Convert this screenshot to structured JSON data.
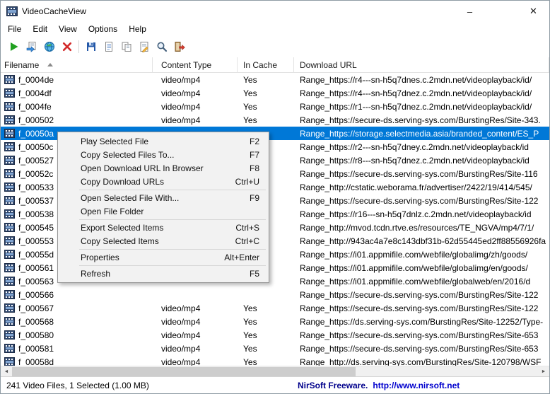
{
  "window": {
    "title": "VideoCacheView",
    "minimize_glyph": "–",
    "close_glyph": "✕"
  },
  "menubar": {
    "items": [
      "File",
      "Edit",
      "View",
      "Options",
      "Help"
    ]
  },
  "toolbar": {
    "buttons": [
      "play",
      "copy-files-to",
      "open-in-browser",
      "delete",
      "separator",
      "save",
      "properties",
      "copy",
      "report",
      "find",
      "exit"
    ]
  },
  "table": {
    "columns": [
      "Filename",
      "Content Type",
      "In Cache",
      "Download URL"
    ],
    "sort_column": "Filename",
    "selected_filename": "f_00050a",
    "rows": [
      {
        "filename": "f_0004de",
        "content_type": "video/mp4",
        "in_cache": "Yes",
        "url": "Range_https://r4---sn-h5q7dnes.c.2mdn.net/videoplayback/id/"
      },
      {
        "filename": "f_0004df",
        "content_type": "video/mp4",
        "in_cache": "Yes",
        "url": "Range_https://r4---sn-h5q7dnez.c.2mdn.net/videoplayback/id/"
      },
      {
        "filename": "f_0004fe",
        "content_type": "video/mp4",
        "in_cache": "Yes",
        "url": "Range_https://r1---sn-h5q7dnez.c.2mdn.net/videoplayback/id/"
      },
      {
        "filename": "f_000502",
        "content_type": "video/mp4",
        "in_cache": "Yes",
        "url": "Range_https://secure-ds.serving-sys.com/BurstingRes/Site-343."
      },
      {
        "filename": "f_00050a",
        "content_type": "",
        "in_cache": "",
        "url": "Range_https://storage.selectmedia.asia/branded_content/ES_P"
      },
      {
        "filename": "f_00050c",
        "content_type": "",
        "in_cache": "",
        "url": "Range_https://r2---sn-h5q7dney.c.2mdn.net/videoplayback/id"
      },
      {
        "filename": "f_000527",
        "content_type": "",
        "in_cache": "",
        "url": "Range_https://r8---sn-h5q7dnez.c.2mdn.net/videoplayback/id"
      },
      {
        "filename": "f_00052c",
        "content_type": "",
        "in_cache": "",
        "url": "Range_https://secure-ds.serving-sys.com/BurstingRes/Site-116"
      },
      {
        "filename": "f_000533",
        "content_type": "",
        "in_cache": "",
        "url": "Range_http://cstatic.weborama.fr/advertiser/2422/19/414/545/"
      },
      {
        "filename": "f_000537",
        "content_type": "",
        "in_cache": "",
        "url": "Range_https://secure-ds.serving-sys.com/BurstingRes/Site-122"
      },
      {
        "filename": "f_000538",
        "content_type": "",
        "in_cache": "",
        "url": "Range_https://r16---sn-h5q7dnlz.c.2mdn.net/videoplayback/id"
      },
      {
        "filename": "f_000545",
        "content_type": "",
        "in_cache": "",
        "url": "Range_http://mvod.tcdn.rtve.es/resources/TE_NGVA/mp4/7/1/"
      },
      {
        "filename": "f_000553",
        "content_type": "",
        "in_cache": "",
        "url": "Range_http://943ac4a7e8c143dbf31b-62d55445ed2ff88556926fa"
      },
      {
        "filename": "f_00055d",
        "content_type": "",
        "in_cache": "",
        "url": "Range_https://i01.appmifile.com/webfile/globalimg/zh/goods/"
      },
      {
        "filename": "f_000561",
        "content_type": "",
        "in_cache": "",
        "url": "Range_https://i01.appmifile.com/webfile/globalimg/en/goods/"
      },
      {
        "filename": "f_000563",
        "content_type": "",
        "in_cache": "",
        "url": "Range_https://i01.appmifile.com/webfile/globalweb/en/2016/d"
      },
      {
        "filename": "f_000566",
        "content_type": "",
        "in_cache": "",
        "url": "Range_https://secure-ds.serving-sys.com/BurstingRes/Site-122"
      },
      {
        "filename": "f_000567",
        "content_type": "video/mp4",
        "in_cache": "Yes",
        "url": "Range_https://secure-ds.serving-sys.com/BurstingRes/Site-122"
      },
      {
        "filename": "f_000568",
        "content_type": "video/mp4",
        "in_cache": "Yes",
        "url": "Range_https://ds.serving-sys.com/BurstingRes/Site-12252/Type-"
      },
      {
        "filename": "f_000580",
        "content_type": "video/mp4",
        "in_cache": "Yes",
        "url": "Range_https://secure-ds.serving-sys.com/BurstingRes/Site-653"
      },
      {
        "filename": "f_000581",
        "content_type": "video/mp4",
        "in_cache": "Yes",
        "url": "Range_https://secure-ds.serving-sys.com/BurstingRes/Site-653"
      },
      {
        "filename": "f_00058d",
        "content_type": "video/mp4",
        "in_cache": "Yes",
        "url": "Range_http://ds.serving-sys.com/BurstingRes/Site-120798/WSF"
      }
    ]
  },
  "context_menu": {
    "items": [
      {
        "label": "Play Selected File",
        "shortcut": "F2"
      },
      {
        "label": "Copy Selected Files To...",
        "shortcut": "F7"
      },
      {
        "label": "Open Download URL In Browser",
        "shortcut": "F8"
      },
      {
        "label": "Copy Download URLs",
        "shortcut": "Ctrl+U"
      },
      {
        "separator": true
      },
      {
        "label": "Open Selected File With...",
        "shortcut": "F9"
      },
      {
        "label": "Open File Folder",
        "shortcut": ""
      },
      {
        "separator": true
      },
      {
        "label": "Export Selected Items",
        "shortcut": "Ctrl+S"
      },
      {
        "label": "Copy Selected Items",
        "shortcut": "Ctrl+C"
      },
      {
        "separator": true
      },
      {
        "label": "Properties",
        "shortcut": "Alt+Enter"
      },
      {
        "separator": true
      },
      {
        "label": "Refresh",
        "shortcut": "F5"
      }
    ]
  },
  "scrollbar": {
    "left_arrow": "◄",
    "right_arrow": "►"
  },
  "statusbar": {
    "left": "241 Video Files, 1 Selected  (1.00 MB)",
    "brand": "NirSoft Freeware.",
    "link": "http://www.nirsoft.net"
  }
}
